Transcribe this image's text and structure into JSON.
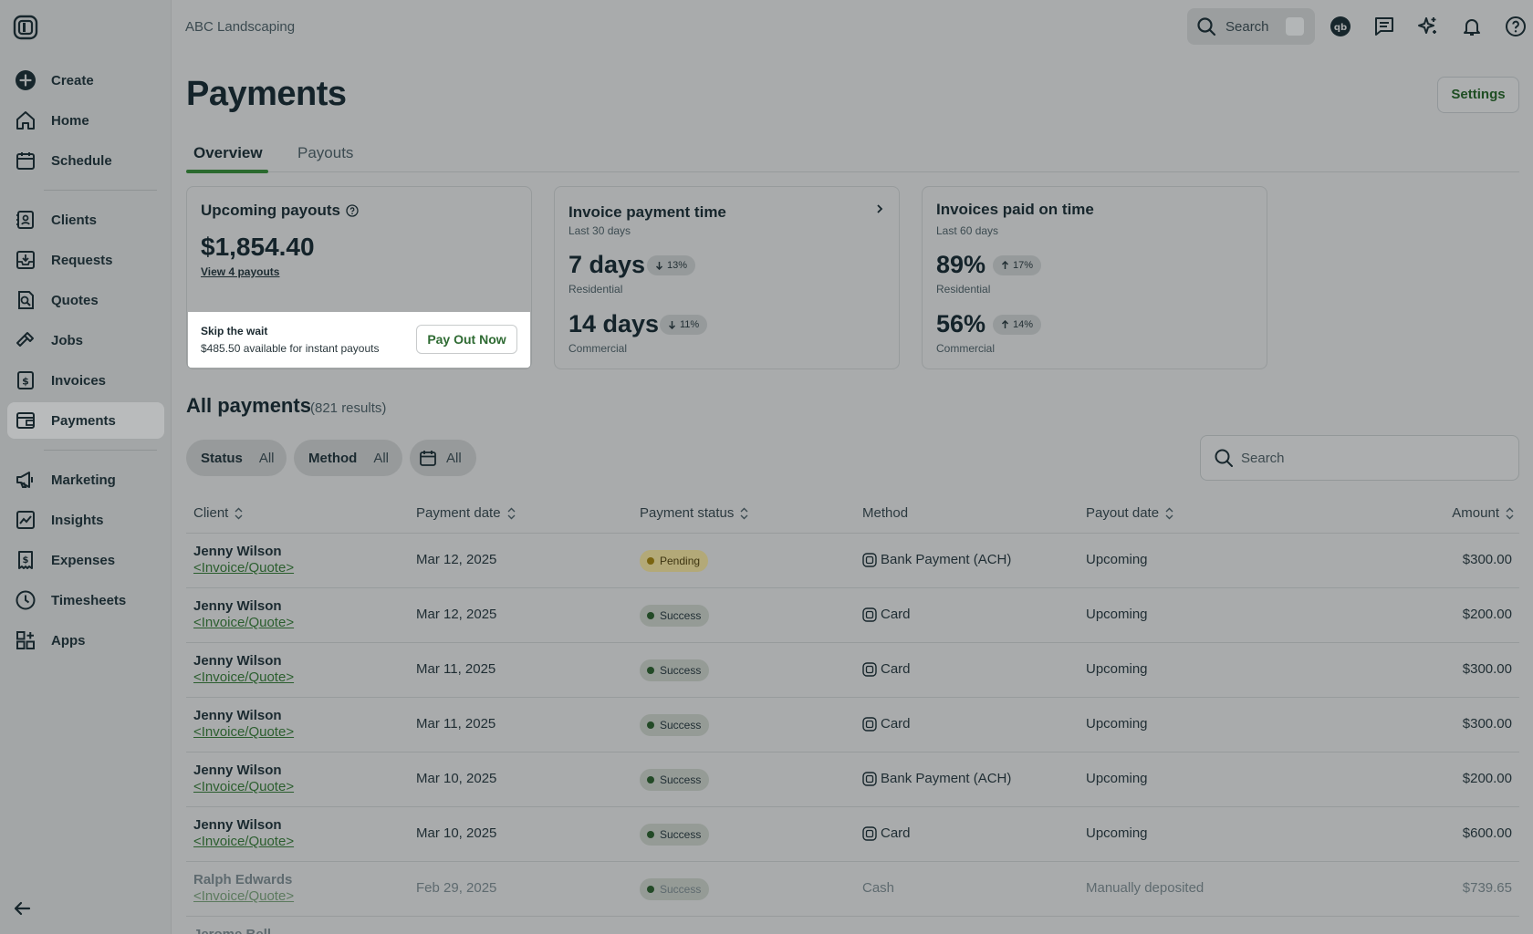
{
  "topbar": {
    "company": "ABC Landscaping",
    "search_label": "Search"
  },
  "sidebar": {
    "items": [
      {
        "label": "Create",
        "icon": "plus-circle-icon"
      },
      {
        "label": "Home",
        "icon": "home-icon"
      },
      {
        "label": "Schedule",
        "icon": "calendar-icon"
      },
      {
        "label": "Clients",
        "icon": "clients-icon"
      },
      {
        "label": "Requests",
        "icon": "requests-icon"
      },
      {
        "label": "Quotes",
        "icon": "quotes-icon"
      },
      {
        "label": "Jobs",
        "icon": "hammer-icon"
      },
      {
        "label": "Invoices",
        "icon": "invoice-icon"
      },
      {
        "label": "Payments",
        "icon": "payments-icon"
      },
      {
        "label": "Marketing",
        "icon": "megaphone-icon"
      },
      {
        "label": "Insights",
        "icon": "insights-icon"
      },
      {
        "label": "Expenses",
        "icon": "expenses-icon"
      },
      {
        "label": "Timesheets",
        "icon": "clock-icon"
      },
      {
        "label": "Apps",
        "icon": "apps-icon"
      }
    ],
    "active": "Payments"
  },
  "header": {
    "title": "Payments",
    "settings_label": "Settings"
  },
  "tabs": [
    {
      "label": "Overview"
    },
    {
      "label": "Payouts"
    }
  ],
  "cards": {
    "upcoming": {
      "title": "Upcoming payouts",
      "amount": "$1,854.40",
      "link": "View 4 payouts",
      "skip_title": "Skip the wait",
      "skip_sub": "$485.50 available for instant payouts",
      "button": "Pay Out Now"
    },
    "payment_time": {
      "title": "Invoice payment time",
      "sub": "Last 30 days",
      "metrics": [
        {
          "value": "7 days",
          "trend": "13%",
          "direction": "down",
          "label": "Residential"
        },
        {
          "value": "14 days",
          "trend": "11%",
          "direction": "down",
          "label": "Commercial"
        }
      ]
    },
    "paid_on_time": {
      "title": "Invoices paid on time",
      "sub": "Last 60 days",
      "metrics": [
        {
          "value": "89%",
          "trend": "17%",
          "direction": "up",
          "label": "Residential"
        },
        {
          "value": "56%",
          "trend": "14%",
          "direction": "up",
          "label": "Commercial"
        }
      ]
    }
  },
  "all_payments": {
    "title": "All payments",
    "results": "(821 results)",
    "filters": [
      {
        "key": "Status",
        "value": "All"
      },
      {
        "key": "Method",
        "value": "All"
      },
      {
        "key": "",
        "value": "All"
      }
    ],
    "search_placeholder": "Search",
    "columns": [
      "Client",
      "Payment date",
      "Payment status",
      "Method",
      "Payout date",
      "Amount"
    ],
    "rows": [
      {
        "client": "Jenny Wilson",
        "link": "<Invoice/Quote>",
        "date": "Mar 12, 2025",
        "status": "Pending",
        "method": "Bank Payment (ACH)",
        "method_icon": true,
        "payout": "Upcoming",
        "amount": "$300.00"
      },
      {
        "client": "Jenny Wilson",
        "link": "<Invoice/Quote>",
        "date": "Mar 12, 2025",
        "status": "Success",
        "method": "Card",
        "method_icon": true,
        "payout": "Upcoming",
        "amount": "$200.00"
      },
      {
        "client": "Jenny Wilson",
        "link": "<Invoice/Quote>",
        "date": "Mar 11, 2025",
        "status": "Success",
        "method": "Card",
        "method_icon": true,
        "payout": "Upcoming",
        "amount": "$300.00"
      },
      {
        "client": "Jenny Wilson",
        "link": "<Invoice/Quote>",
        "date": "Mar 11, 2025",
        "status": "Success",
        "method": "Card",
        "method_icon": true,
        "payout": "Upcoming",
        "amount": "$300.00"
      },
      {
        "client": "Jenny Wilson",
        "link": "<Invoice/Quote>",
        "date": "Mar 10, 2025",
        "status": "Success",
        "method": "Bank Payment (ACH)",
        "method_icon": true,
        "payout": "Upcoming",
        "amount": "$200.00"
      },
      {
        "client": "Jenny Wilson",
        "link": "<Invoice/Quote>",
        "date": "Mar 10, 2025",
        "status": "Success",
        "method": "Card",
        "method_icon": true,
        "payout": "Upcoming",
        "amount": "$600.00"
      },
      {
        "client": "Ralph Edwards",
        "link": "<Invoice/Quote>",
        "date": "Feb 29, 2025",
        "status": "Success",
        "method": "Cash",
        "method_icon": false,
        "payout": "Manually deposited",
        "amount": "$739.65"
      },
      {
        "client": "Jerome Bell",
        "link": "",
        "date": "",
        "status": "",
        "method": "",
        "method_icon": false,
        "payout": "",
        "amount": ""
      }
    ]
  },
  "colors": {
    "brand_green": "#2b6a2f",
    "pending_bg": "#b3a978",
    "pending_dot": "#7a6410",
    "success_bg": "#959b96",
    "success_dot": "#234a27"
  }
}
